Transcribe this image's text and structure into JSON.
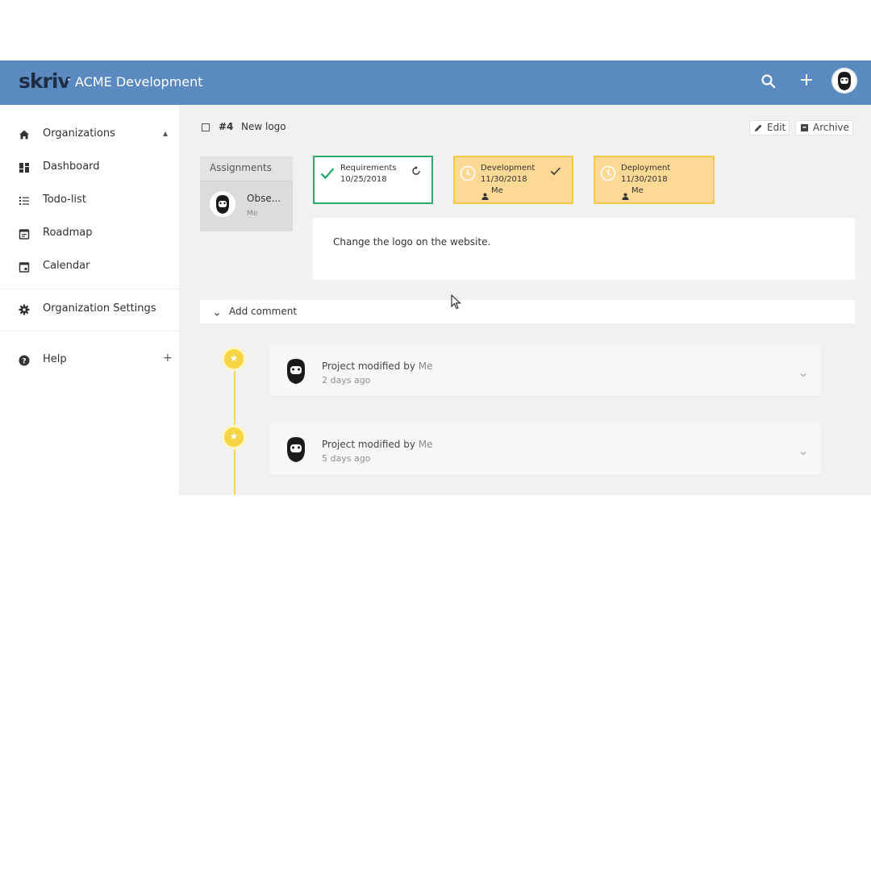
{
  "header": {
    "logo": "skriv",
    "separator": "‣",
    "breadcrumb": "ACME Development",
    "add_symbol": "+",
    "search_icon": "search-icon",
    "avatar_icon": "user-avatar-icon",
    "background_color": "#5b8ac1"
  },
  "sidebar": {
    "items": [
      {
        "label": "Organizations",
        "icon": "home-icon",
        "toggle": "▴"
      },
      {
        "label": "Dashboard",
        "icon": "dashboard-icon"
      },
      {
        "label": "Todo-list",
        "icon": "list-icon"
      },
      {
        "label": "Roadmap",
        "icon": "roadmap-icon"
      },
      {
        "label": "Calendar",
        "icon": "calendar-icon"
      },
      {
        "label": "Organization Settings",
        "icon": "gear-icon"
      },
      {
        "label": "Help",
        "icon": "help-icon",
        "toggle": "+"
      }
    ]
  },
  "task": {
    "id": "#4",
    "title": "New logo",
    "edit_label": "Edit",
    "archive_label": "Archive"
  },
  "assignments": {
    "title": "Assignments",
    "name": "Obse...",
    "sub": "Me"
  },
  "stages": [
    {
      "name": "Requirements",
      "date": "10/25/2018",
      "user": "",
      "status": "done",
      "status_icon": "refresh-icon",
      "border_color": "#2aaa6f"
    },
    {
      "name": "Development",
      "date": "11/30/2018",
      "user": "Me",
      "status": "pending",
      "status_icon": "check-icon",
      "border_color": "#f4c94c"
    },
    {
      "name": "Deployment",
      "date": "11/30/2018",
      "user": "Me",
      "status": "pending",
      "status_icon": "",
      "border_color": "#f4c94c"
    }
  ],
  "description": "Change the logo on the website.",
  "comment": {
    "label": "Add comment"
  },
  "activity": [
    {
      "text": "Project modified by",
      "by": "Me",
      "time": "2 days ago"
    },
    {
      "text": "Project modified by",
      "by": "Me",
      "time": "5 days ago"
    }
  ],
  "timeline_star": "★"
}
